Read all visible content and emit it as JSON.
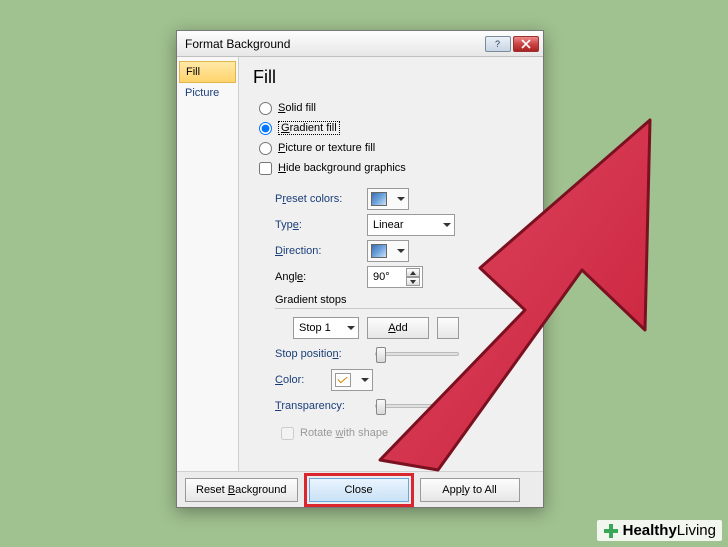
{
  "dialog": {
    "title": "Format Background"
  },
  "sidebar": {
    "items": [
      {
        "label": "Fill",
        "active": true
      },
      {
        "label": "Picture",
        "active": false
      }
    ]
  },
  "main": {
    "heading": "Fill",
    "fill_options": {
      "solid": "Solid fill",
      "gradient": "Gradient fill",
      "picture": "Picture or texture fill",
      "hide_bg": "Hide background graphics",
      "selected": "gradient"
    },
    "preset_colors_label": "Preset colors:",
    "type_label": "Type:",
    "type_value": "Linear",
    "direction_label": "Direction:",
    "angle_label": "Angle:",
    "angle_value": "90°",
    "gradient_stops_label": "Gradient stops",
    "stop_value": "Stop 1",
    "add_label": "Add",
    "stop_position_label": "Stop position:",
    "color_label": "Color:",
    "transparency_label": "Transparency:",
    "rotate_label": "Rotate with shape"
  },
  "footer": {
    "reset": "Reset Background",
    "close": "Close",
    "apply": "Apply to All"
  },
  "watermark": {
    "brand_bold": "Healthy",
    "brand_light": "Living"
  }
}
